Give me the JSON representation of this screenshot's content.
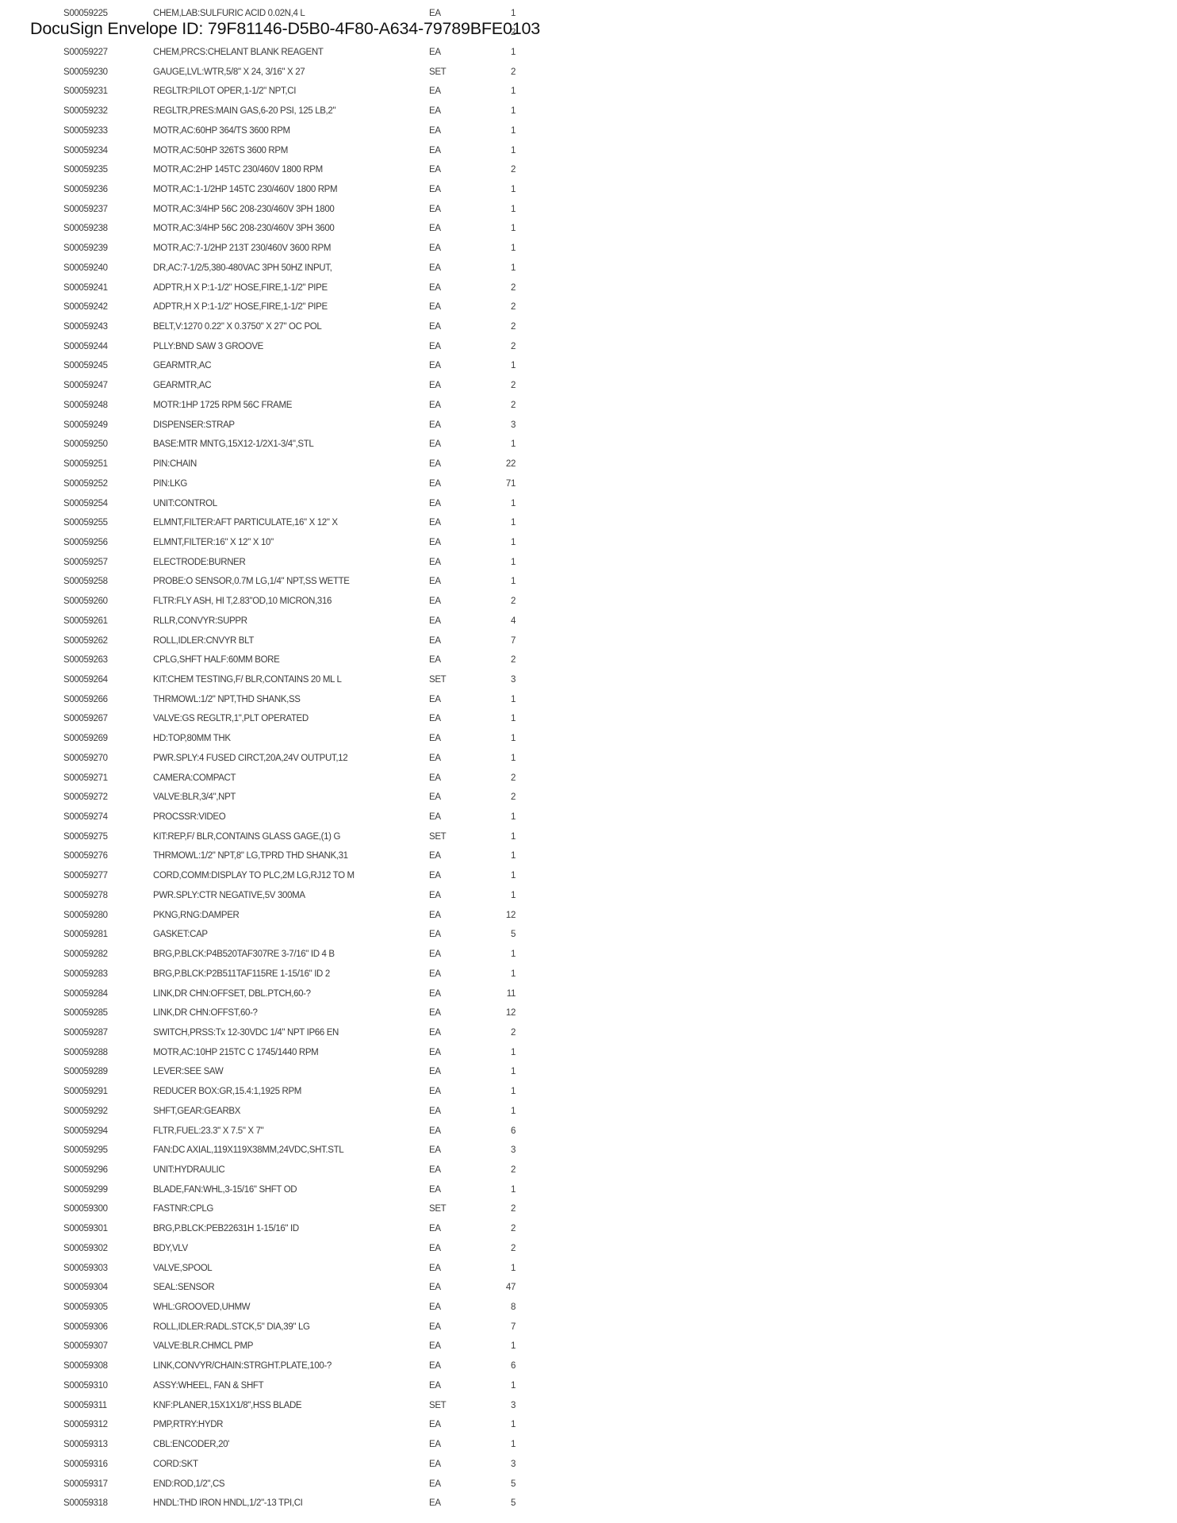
{
  "envelope_header": "DocuSign Envelope ID: 79F81146-D5B0-4F80-A634-79789BFE0103",
  "items": [
    {
      "id": "S00059225",
      "desc": "CHEM,LAB:SULFURIC ACID 0.02N,4 L",
      "unit": "EA",
      "qty": "1"
    },
    {
      "id": "",
      "desc": "",
      "unit": "",
      "qty": "2"
    },
    {
      "id": "S00059227",
      "desc": "CHEM,PRCS:CHELANT BLANK REAGENT",
      "unit": "EA",
      "qty": "1"
    },
    {
      "id": "S00059230",
      "desc": "GAUGE,LVL:WTR,5/8\" X 24, 3/16\" X 27",
      "unit": "SET",
      "qty": "2"
    },
    {
      "id": "S00059231",
      "desc": "REGLTR:PILOT OPER,1-1/2\" NPT,CI",
      "unit": "EA",
      "qty": "1"
    },
    {
      "id": "S00059232",
      "desc": "REGLTR,PRES:MAIN GAS,6-20 PSI, 125 LB,2\"",
      "unit": "EA",
      "qty": "1"
    },
    {
      "id": "S00059233",
      "desc": "MOTR,AC:60HP 364/TS 3600 RPM",
      "unit": "EA",
      "qty": "1"
    },
    {
      "id": "S00059234",
      "desc": "MOTR,AC:50HP 326TS 3600 RPM",
      "unit": "EA",
      "qty": "1"
    },
    {
      "id": "S00059235",
      "desc": "MOTR,AC:2HP 145TC 230/460V 1800 RPM",
      "unit": "EA",
      "qty": "2"
    },
    {
      "id": "S00059236",
      "desc": "MOTR,AC:1-1/2HP 145TC 230/460V 1800 RPM",
      "unit": "EA",
      "qty": "1"
    },
    {
      "id": "S00059237",
      "desc": "MOTR,AC:3/4HP 56C 208-230/460V 3PH 1800",
      "unit": "EA",
      "qty": "1"
    },
    {
      "id": "S00059238",
      "desc": "MOTR,AC:3/4HP 56C 208-230/460V 3PH 3600",
      "unit": "EA",
      "qty": "1"
    },
    {
      "id": "S00059239",
      "desc": "MOTR,AC:7-1/2HP 213T 230/460V 3600 RPM",
      "unit": "EA",
      "qty": "1"
    },
    {
      "id": "S00059240",
      "desc": "DR,AC:7-1/2/5,380-480VAC 3PH 50HZ INPUT,",
      "unit": "EA",
      "qty": "1"
    },
    {
      "id": "S00059241",
      "desc": "ADPTR,H X P:1-1/2\" HOSE,FIRE,1-1/2\" PIPE",
      "unit": "EA",
      "qty": "2"
    },
    {
      "id": "S00059242",
      "desc": "ADPTR,H X P:1-1/2\" HOSE,FIRE,1-1/2\" PIPE",
      "unit": "EA",
      "qty": "2"
    },
    {
      "id": "S00059243",
      "desc": "BELT,V:1270 0.22\" X 0.3750\" X 27\" OC POL",
      "unit": "EA",
      "qty": "2"
    },
    {
      "id": "S00059244",
      "desc": "PLLY:BND SAW 3 GROOVE",
      "unit": "EA",
      "qty": "2"
    },
    {
      "id": "S00059245",
      "desc": "GEARMTR,AC",
      "unit": "EA",
      "qty": "1"
    },
    {
      "id": "S00059247",
      "desc": "GEARMTR,AC",
      "unit": "EA",
      "qty": "2"
    },
    {
      "id": "S00059248",
      "desc": "MOTR:1HP 1725 RPM 56C FRAME",
      "unit": "EA",
      "qty": "2"
    },
    {
      "id": "S00059249",
      "desc": "DISPENSER:STRAP",
      "unit": "EA",
      "qty": "3"
    },
    {
      "id": "S00059250",
      "desc": "BASE:MTR MNTG,15X12-1/2X1-3/4\",STL",
      "unit": "EA",
      "qty": "1"
    },
    {
      "id": "S00059251",
      "desc": "PIN:CHAIN",
      "unit": "EA",
      "qty": "22"
    },
    {
      "id": "S00059252",
      "desc": "PIN:LKG",
      "unit": "EA",
      "qty": "71"
    },
    {
      "id": "S00059254",
      "desc": "UNIT:CONTROL",
      "unit": "EA",
      "qty": "1"
    },
    {
      "id": "S00059255",
      "desc": "ELMNT,FILTER:AFT PARTICULATE,16\" X 12\" X",
      "unit": "EA",
      "qty": "1"
    },
    {
      "id": "S00059256",
      "desc": "ELMNT,FILTER:16\" X 12\" X 10\"",
      "unit": "EA",
      "qty": "1"
    },
    {
      "id": "S00059257",
      "desc": "ELECTRODE:BURNER",
      "unit": "EA",
      "qty": "1"
    },
    {
      "id": "S00059258",
      "desc": "PROBE:O SENSOR,0.7M LG,1/4\" NPT,SS WETTE",
      "unit": "EA",
      "qty": "1"
    },
    {
      "id": "S00059260",
      "desc": "FLTR:FLY ASH, HI T,2.83\"OD,10 MICRON,316",
      "unit": "EA",
      "qty": "2"
    },
    {
      "id": "S00059261",
      "desc": "RLLR,CONVYR:SUPPR",
      "unit": "EA",
      "qty": "4"
    },
    {
      "id": "S00059262",
      "desc": "ROLL,IDLER:CNVYR BLT",
      "unit": "EA",
      "qty": "7"
    },
    {
      "id": "S00059263",
      "desc": "CPLG,SHFT HALF:60MM BORE",
      "unit": "EA",
      "qty": "2"
    },
    {
      "id": "S00059264",
      "desc": "KIT:CHEM TESTING,F/ BLR,CONTAINS 20 ML L",
      "unit": "SET",
      "qty": "3"
    },
    {
      "id": "S00059266",
      "desc": "THRMOWL:1/2\" NPT,THD SHANK,SS",
      "unit": "EA",
      "qty": "1"
    },
    {
      "id": "S00059267",
      "desc": "VALVE:GS REGLTR,1\",PLT OPERATED",
      "unit": "EA",
      "qty": "1"
    },
    {
      "id": "S00059269",
      "desc": "HD:TOP,80MM THK",
      "unit": "EA",
      "qty": "1"
    },
    {
      "id": "S00059270",
      "desc": "PWR.SPLY:4 FUSED CIRCT,20A,24V OUTPUT,12",
      "unit": "EA",
      "qty": "1"
    },
    {
      "id": "S00059271",
      "desc": "CAMERA:COMPACT",
      "unit": "EA",
      "qty": "2"
    },
    {
      "id": "S00059272",
      "desc": "VALVE:BLR,3/4\",NPT",
      "unit": "EA",
      "qty": "2"
    },
    {
      "id": "S00059274",
      "desc": "PROCSSR:VIDEO",
      "unit": "EA",
      "qty": "1"
    },
    {
      "id": "S00059275",
      "desc": "KIT:REP,F/ BLR,CONTAINS GLASS GAGE,(1) G",
      "unit": "SET",
      "qty": "1"
    },
    {
      "id": "S00059276",
      "desc": "THRMOWL:1/2\" NPT,8\" LG,TPRD THD SHANK,31",
      "unit": "EA",
      "qty": "1"
    },
    {
      "id": "S00059277",
      "desc": "CORD,COMM:DISPLAY TO PLC,2M LG,RJ12 TO M",
      "unit": "EA",
      "qty": "1"
    },
    {
      "id": "S00059278",
      "desc": "PWR.SPLY:CTR NEGATIVE,5V 300MA",
      "unit": "EA",
      "qty": "1"
    },
    {
      "id": "S00059280",
      "desc": "PKNG,RNG:DAMPER",
      "unit": "EA",
      "qty": "12"
    },
    {
      "id": "S00059281",
      "desc": "GASKET:CAP",
      "unit": "EA",
      "qty": "5"
    },
    {
      "id": "S00059282",
      "desc": "BRG,P.BLCK:P4B520TAF307RE 3-7/16\" ID 4 B",
      "unit": "EA",
      "qty": "1"
    },
    {
      "id": "S00059283",
      "desc": "BRG,P.BLCK:P2B511TAF115RE 1-15/16\" ID 2",
      "unit": "EA",
      "qty": "1"
    },
    {
      "id": "S00059284",
      "desc": "LINK,DR CHN:OFFSET, DBL.PTCH,60-?",
      "unit": "EA",
      "qty": "11"
    },
    {
      "id": "S00059285",
      "desc": "LINK,DR CHN:OFFST,60-?",
      "unit": "EA",
      "qty": "12"
    },
    {
      "id": "S00059287",
      "desc": "SWITCH,PRSS:Tx 12-30VDC 1/4\" NPT IP66 EN",
      "unit": "EA",
      "qty": "2"
    },
    {
      "id": "S00059288",
      "desc": "MOTR,AC:10HP 215TC C 1745/1440 RPM",
      "unit": "EA",
      "qty": "1"
    },
    {
      "id": "S00059289",
      "desc": "LEVER:SEE SAW",
      "unit": "EA",
      "qty": "1"
    },
    {
      "id": "S00059291",
      "desc": "REDUCER BOX:GR,15.4:1,1925 RPM",
      "unit": "EA",
      "qty": "1"
    },
    {
      "id": "S00059292",
      "desc": "SHFT,GEAR:GEARBX",
      "unit": "EA",
      "qty": "1"
    },
    {
      "id": "S00059294",
      "desc": "FLTR,FUEL:23.3\" X 7.5\" X 7\"",
      "unit": "EA",
      "qty": "6"
    },
    {
      "id": "S00059295",
      "desc": "FAN:DC AXIAL,119X119X38MM,24VDC,SHT.STL",
      "unit": "EA",
      "qty": "3"
    },
    {
      "id": "S00059296",
      "desc": "UNIT:HYDRAULIC",
      "unit": "EA",
      "qty": "2"
    },
    {
      "id": "S00059299",
      "desc": "BLADE,FAN:WHL,3-15/16\" SHFT OD",
      "unit": "EA",
      "qty": "1"
    },
    {
      "id": "S00059300",
      "desc": "FASTNR:CPLG",
      "unit": "SET",
      "qty": "2"
    },
    {
      "id": "S00059301",
      "desc": "BRG,P.BLCK:PEB22631H 1-15/16\" ID",
      "unit": "EA",
      "qty": "2"
    },
    {
      "id": "S00059302",
      "desc": "BDY,VLV",
      "unit": "EA",
      "qty": "2"
    },
    {
      "id": "S00059303",
      "desc": "VALVE,SPOOL",
      "unit": "EA",
      "qty": "1"
    },
    {
      "id": "S00059304",
      "desc": "SEAL:SENSOR",
      "unit": "EA",
      "qty": "47"
    },
    {
      "id": "S00059305",
      "desc": "WHL:GROOVED,UHMW",
      "unit": "EA",
      "qty": "8"
    },
    {
      "id": "S00059306",
      "desc": "ROLL,IDLER:RADL.STCK,5\" DIA,39\" LG",
      "unit": "EA",
      "qty": "7"
    },
    {
      "id": "S00059307",
      "desc": "VALVE:BLR.CHMCL PMP",
      "unit": "EA",
      "qty": "1"
    },
    {
      "id": "S00059308",
      "desc": "LINK,CONVYR/CHAIN:STRGHT.PLATE,100-?",
      "unit": "EA",
      "qty": "6"
    },
    {
      "id": "S00059310",
      "desc": "ASSY:WHEEL, FAN & SHFT",
      "unit": "EA",
      "qty": "1"
    },
    {
      "id": "S00059311",
      "desc": "KNF:PLANER,15X1X1/8\",HSS BLADE",
      "unit": "SET",
      "qty": "3"
    },
    {
      "id": "S00059312",
      "desc": "PMP,RTRY:HYDR",
      "unit": "EA",
      "qty": "1"
    },
    {
      "id": "S00059313",
      "desc": "CBL:ENCODER,20'",
      "unit": "EA",
      "qty": "1"
    },
    {
      "id": "S00059316",
      "desc": "CORD:SKT",
      "unit": "EA",
      "qty": "3"
    },
    {
      "id": "S00059317",
      "desc": "END:ROD,1/2\",CS",
      "unit": "EA",
      "qty": "5"
    },
    {
      "id": "S00059318",
      "desc": "HNDL:THD IRON HNDL,1/2\"-13 TPI,CI",
      "unit": "EA",
      "qty": "5"
    }
  ]
}
